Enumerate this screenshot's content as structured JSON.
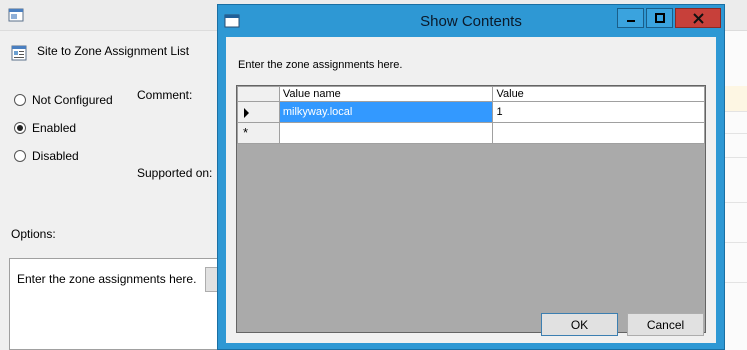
{
  "background_window": {
    "policy_title": "Site to Zone Assignment List",
    "radio_options": [
      {
        "label": "Not Configured",
        "checked": false
      },
      {
        "label": "Enabled",
        "checked": true
      },
      {
        "label": "Disabled",
        "checked": false
      }
    ],
    "comment_label": "Comment:",
    "supported_label": "Supported on:",
    "options_label": "Options:",
    "options_text": "Enter the zone assignments here."
  },
  "dialog": {
    "title": "Show Contents",
    "prompt": "Enter the zone assignments here.",
    "grid": {
      "columns": [
        "Value name",
        "Value"
      ],
      "rows": [
        {
          "name": "milkyway.local",
          "value": "1",
          "selected": true
        }
      ]
    },
    "ok_label": "OK",
    "cancel_label": "Cancel"
  },
  "colors": {
    "titlebar_accent": "#2e98d4",
    "close_button": "#c7403a",
    "selection": "#3399ff"
  }
}
